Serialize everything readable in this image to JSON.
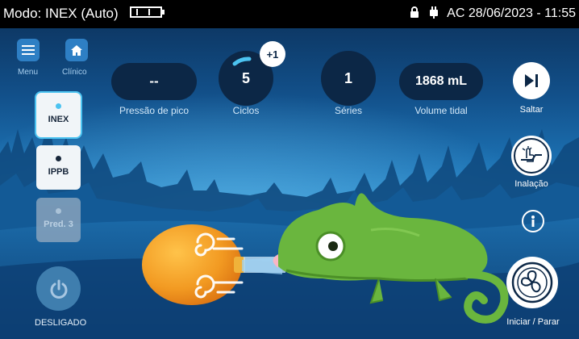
{
  "statusbar": {
    "mode_text": "Modo: INEX (Auto)",
    "power_text": "AC",
    "datetime": "28/06/2023 - 11:55"
  },
  "nav": {
    "menu_label": "Menu",
    "clinical_label": "Clínico"
  },
  "metrics": {
    "peak_pressure": {
      "value": "--",
      "label": "Pressão de pico"
    },
    "cycles": {
      "value": "5",
      "label": "Ciclos",
      "badge": "+1"
    },
    "series": {
      "value": "1",
      "label": "Séries"
    },
    "tidal_volume": {
      "value": "1868 mL",
      "label": "Volume tidal"
    }
  },
  "modes": [
    {
      "label": "INEX",
      "state": "selected"
    },
    {
      "label": "IPPB",
      "state": "available"
    },
    {
      "label": "Pred. 3",
      "state": "disabled"
    }
  ],
  "power": {
    "label": "DESLIGADO"
  },
  "right_controls": {
    "skip_label": "Saltar",
    "inhalation_label": "Inalação",
    "start_stop_label": "Iniciar / Parar"
  },
  "colors": {
    "background_dark": "#0b2f57",
    "metric_pill": "#0c2746",
    "accent_cyan": "#4cc3f0",
    "chameleon_green": "#6ab63e",
    "balloon_orange": "#f29a22"
  },
  "icons": [
    "battery-icon",
    "lock-icon",
    "plug-icon",
    "menu-icon",
    "home-icon",
    "power-icon",
    "skip-icon",
    "inhalation-icon",
    "info-icon",
    "fan-icon"
  ]
}
